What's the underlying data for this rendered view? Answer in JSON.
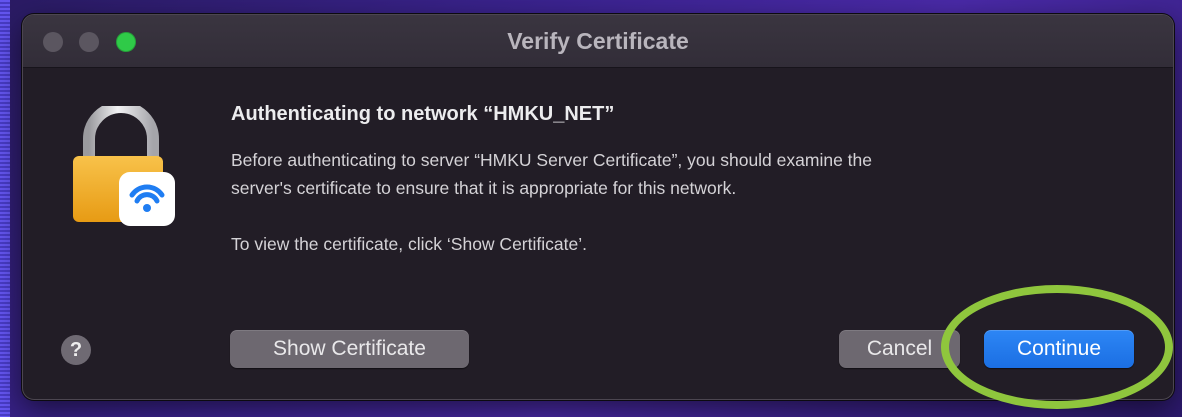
{
  "window": {
    "title": "Verify Certificate"
  },
  "dialog": {
    "heading": "Authenticating to network “HMKU_NET”",
    "body_line1": "Before authenticating to server “HMKU Server Certificate”, you should examine the",
    "body_line2": "server's certificate to ensure that it is appropriate for this network.",
    "body_line3": "To view the certificate, click ‘Show Certificate’.",
    "icon": "lock-wifi-icon"
  },
  "buttons": {
    "help_label": "?",
    "show_certificate_label": "Show Certificate",
    "cancel_label": "Cancel",
    "continue_label": "Continue"
  },
  "colors": {
    "default_button": "#1b6fe3",
    "annotation_circle": "#8fc63d",
    "dialog_bg": "#221d26"
  }
}
